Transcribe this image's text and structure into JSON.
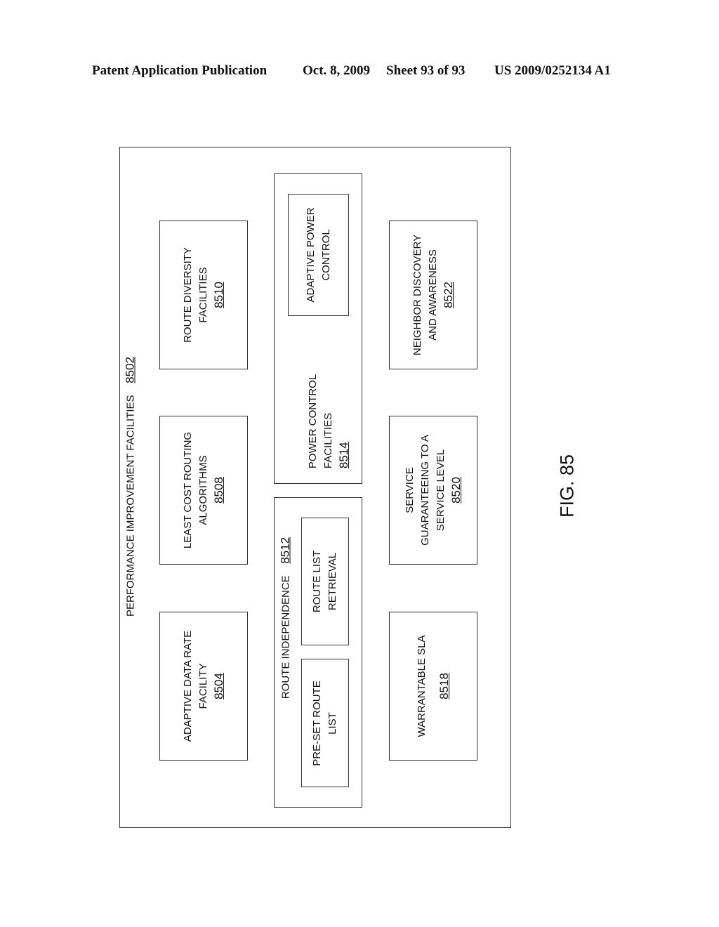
{
  "header": {
    "publication": "Patent Application Publication",
    "date": "Oct. 8, 2009",
    "sheet": "Sheet 93 of 93",
    "number": "US 2009/0252134 A1"
  },
  "outer": {
    "title": "PERFORMANCE IMPROVEMENT FACILITIES",
    "ref": "8502"
  },
  "boxes": {
    "adaptive_data_rate": {
      "line1": "ADAPTIVE DATA RATE",
      "line2": "FACILITY",
      "ref": "8504"
    },
    "least_cost": {
      "line1": "LEAST COST ROUTING",
      "line2": "ALGORITHMS",
      "ref": "8508"
    },
    "route_diversity": {
      "line1": "ROUTE DIVERSITY",
      "line2": "FACILITIES",
      "ref": "8510"
    },
    "route_independence": {
      "title": "ROUTE INDEPENDENCE",
      "ref": "8512",
      "preset": {
        "line1": "PRE-SET ROUTE",
        "line2": "LIST"
      },
      "retrieval": {
        "line1": "ROUTE LIST",
        "line2": "RETRIEVAL"
      }
    },
    "power_control": {
      "line1": "POWER CONTROL",
      "line2": "FACILITIES",
      "ref": "8514",
      "adaptive": {
        "line1": "ADAPTIVE POWER",
        "line2": "CONTROL"
      }
    },
    "warrantable_sla": {
      "line1": "WARRANTABLE SLA",
      "ref": "8518"
    },
    "service_guarantee": {
      "line1": "SERVICE",
      "line2": "GUARANTEEING TO A",
      "line3": "SERVICE LEVEL",
      "ref": "8520"
    },
    "neighbor_discovery": {
      "line1": "NEIGHBOR DISCOVERY",
      "line2": "AND AWARENESS",
      "ref": "8522"
    }
  },
  "figure": {
    "label": "FIG. 85"
  }
}
